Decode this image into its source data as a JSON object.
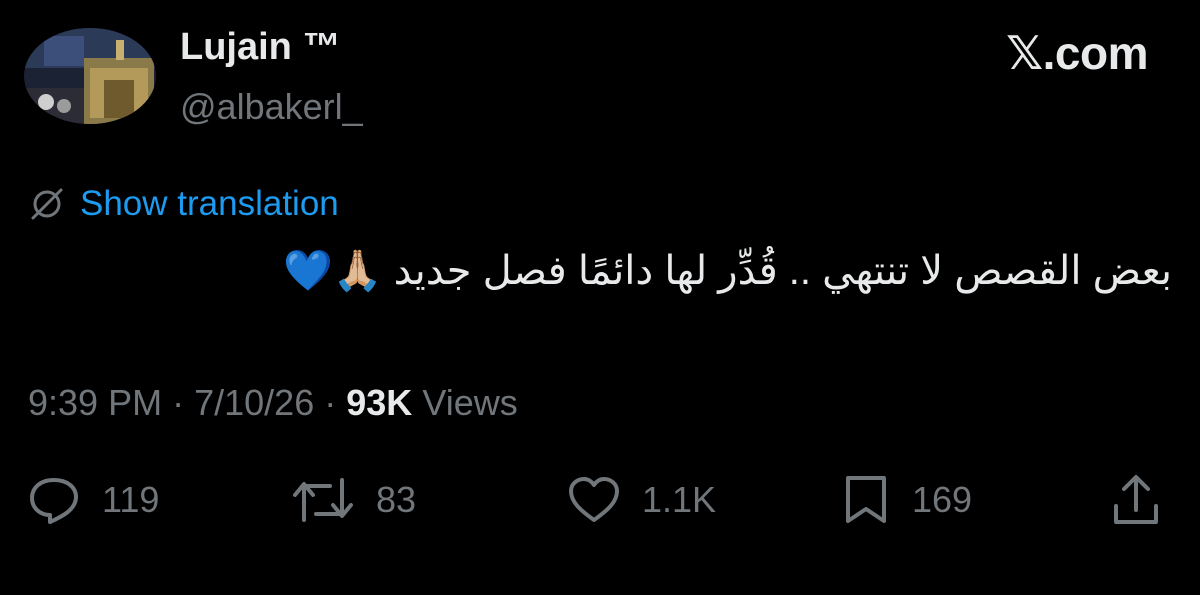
{
  "author": {
    "display_name": "Lujain ™",
    "handle": "@albakerl_"
  },
  "brand": "𝕏.com",
  "translation": {
    "link_label": "Show translation"
  },
  "tweet": {
    "text": "بعض القصص لا تنتهي .. قُدِّر لها دائمًا فصل جديد 🙏🏼💙"
  },
  "meta": {
    "time": "9:39 PM",
    "date": "7/10/26",
    "separator": "·",
    "views_count": "93K",
    "views_label": "Views"
  },
  "actions": {
    "replies": "119",
    "reposts": "83",
    "likes": "1.1K",
    "bookmarks": "169"
  },
  "colors": {
    "background": "#000000",
    "primary_text": "#e7e9ea",
    "secondary_text": "#71767b",
    "link": "#1d9bf0"
  }
}
